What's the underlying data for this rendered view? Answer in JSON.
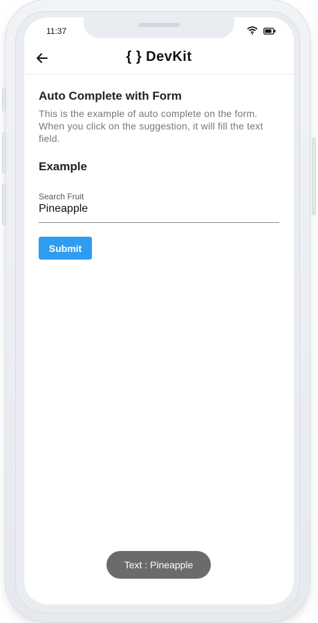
{
  "status_bar": {
    "time": "11:37"
  },
  "app_bar": {
    "logo_text": "{ } DevKit"
  },
  "main": {
    "title": "Auto Complete with Form",
    "description": "This is the example of auto complete on the form. When you click on the suggestion, it will fill the text field.",
    "example_heading": "Example",
    "field_label": "Search Fruit",
    "field_value": "Pineapple",
    "submit_label": "Submit"
  },
  "toast": {
    "text": "Text : Pineapple"
  },
  "colors": {
    "primary": "#2d9cf1",
    "toast_bg": "#6b6b6b"
  }
}
